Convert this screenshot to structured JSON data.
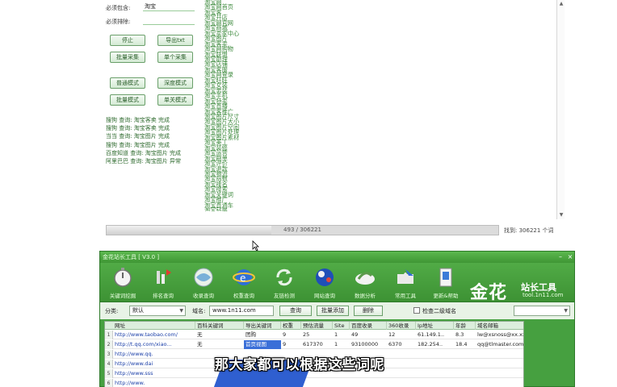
{
  "top_app": {
    "fields": [
      {
        "label": "必须包含:",
        "value": "淘宝"
      },
      {
        "label": "必须排除:",
        "value": ""
      }
    ],
    "buttons": [
      "停止",
      "导出txt",
      "批量采集",
      "单个采集",
      "普通模式",
      "深度模式",
      "批量模式",
      "单关模式"
    ],
    "status_lines": [
      "搜狗 查询: 淘宝客卖 完成",
      "搜狗 查询: 淘宝客卖 完成",
      "当当 查询: 淘宝图片 完成",
      "搜狗 查询: 淘宝图片 完成",
      "百度知道 查询: 淘宝图片 完成",
      "阿里巴巴 查询: 淘宝图片 异常"
    ],
    "keywords": [
      "淘宝网",
      "淘宝网首页",
      "淘宝客",
      "淘宝开店",
      "淘宝网官网",
      "淘宝商城",
      "淘宝卖家中心",
      "淘宝图片",
      "淘宝客卖",
      "淘宝网购物",
      "淘宝联盟",
      "淘宝助理",
      "淘宝店铺",
      "淘宝客服",
      "淘宝网登录",
      "淘宝旺旺",
      "淘宝女装",
      "淘宝男装",
      "淘宝手机",
      "淘宝特卖",
      "淘宝直播",
      "淘宝客推广",
      "淘宝图片尺寸",
      "淘宝图片大小",
      "淘宝图片空间",
      "淘宝图片处理",
      "淘宝图片素材",
      "淘宝美工",
      "淘宝装修",
      "淘宝运营",
      "淘宝刷单",
      "淘宝评价",
      "淘宝退款",
      "淘宝物流",
      "淘宝指数",
      "淘宝排名",
      "淘宝搜索",
      "淘宝关键词",
      "淘宝推广",
      "淘宝直通车",
      "淘宝钻展",
      "淘宝活动",
      "淘宝双十一"
    ],
    "progress": {
      "text": "493 / 306221",
      "fraction": 0.42
    },
    "total": "找到: 306221 个词"
  },
  "tool": {
    "title": "金花站长工具 [ V3.0 ]",
    "toolbar": [
      "关键词挖掘",
      "排名查询",
      "收录查询",
      "权重查询",
      "友链检测",
      "网站查询",
      "数据分析",
      "常用工具",
      "更新&帮助"
    ],
    "logo": {
      "cn": "金花",
      "sub": "站长工具",
      "en": "tool.1n11.com"
    },
    "filter": {
      "category_label": "分类:",
      "category_value": "默认",
      "domain_label": "域名:",
      "domain_value": "www.1n11.com",
      "btn_query": "查询",
      "btn_add": "批量添加",
      "btn_delete": "删除",
      "check_label": "检查二级域名"
    },
    "grid": {
      "headers": [
        "网址",
        "百科关键词",
        "导出关键词",
        "权重",
        "预估流量",
        "Site",
        "百度收录",
        "360收录",
        "Ip地址",
        "年龄",
        "域名邮箱"
      ],
      "rows": [
        {
          "num": "1",
          "url": "http://www.taobao.com/",
          "cells": [
            "无",
            "团购",
            "9",
            "25",
            "1",
            "49",
            "12",
            "61.149.1..",
            "8.3",
            "lw@xsnoss@xx.xxx"
          ]
        },
        {
          "num": "2",
          "url": "http://t.qq.com/xiao...",
          "cells": [
            "无",
            "首页视图",
            "9",
            "617370",
            "1",
            "93100000",
            "6370",
            "182.254..",
            "18.4",
            "qq@tlmaster.com"
          ]
        },
        {
          "num": "3",
          "url": "http://www.qq.",
          "cells": []
        },
        {
          "num": "4",
          "url": "http://www.dai",
          "cells": []
        },
        {
          "num": "5",
          "url": "http://www.sss",
          "cells": []
        },
        {
          "num": "6",
          "url": "http://www.",
          "cells": []
        }
      ]
    }
  },
  "subtitle": "那大家都可以根据这些词呢"
}
